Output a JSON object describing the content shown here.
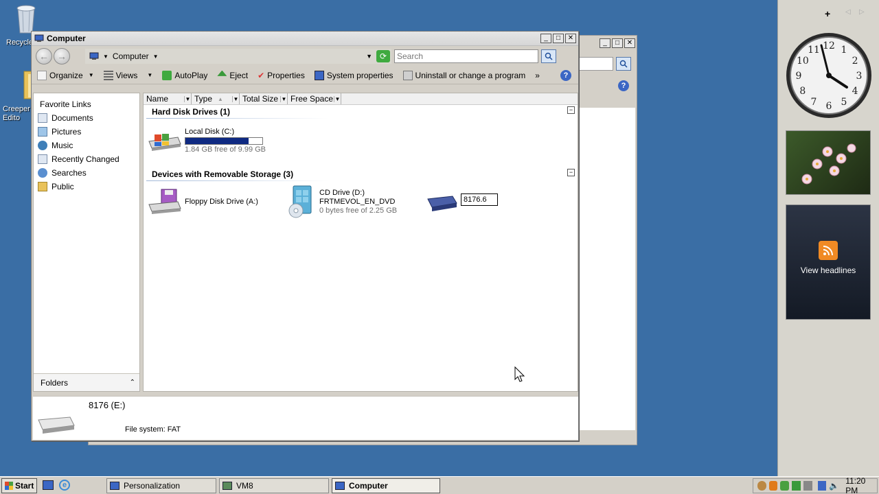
{
  "desktop": {
    "icons": [
      {
        "label": "Recycle"
      },
      {
        "label": "Creeper Edito"
      }
    ]
  },
  "window": {
    "title": "Computer",
    "controls": {
      "minimize": "_",
      "maximize": "□",
      "close": "✕"
    },
    "address": {
      "location": "Computer"
    },
    "search": {
      "placeholder": "Search"
    },
    "toolbar": {
      "organize": "Organize",
      "views": "Views",
      "autoplay": "AutoPlay",
      "eject": "Eject",
      "properties": "Properties",
      "system_properties": "System properties",
      "uninstall": "Uninstall or change a program",
      "more": "»"
    },
    "nav": {
      "header": "Favorite Links",
      "items": [
        {
          "label": "Documents"
        },
        {
          "label": "Pictures"
        },
        {
          "label": "Music"
        },
        {
          "label": "Recently Changed"
        },
        {
          "label": "Searches"
        },
        {
          "label": "Public"
        }
      ],
      "folders": "Folders"
    },
    "columns": [
      "Name",
      "Type",
      "Total Size",
      "Free Space"
    ],
    "groups": {
      "hdd": {
        "title": "Hard Disk Drives (1)",
        "items": [
          {
            "name": "Local Disk (C:)",
            "free": "1.84 GB free of 9.99 GB",
            "used_fraction": 0.82
          }
        ]
      },
      "removable": {
        "title": "Devices with Removable Storage (3)",
        "floppy": {
          "name": "Floppy Disk Drive (A:)"
        },
        "cd": {
          "name": "CD Drive (D:)",
          "volume": "FRTMEVOL_EN_DVD",
          "free": "0 bytes free of 2.25 GB"
        },
        "usb": {
          "rename_value": "8176.6"
        }
      }
    },
    "details": {
      "name": "8176 (E:)",
      "filesystem": "File system: FAT"
    }
  },
  "sidebar": {
    "rss_label": "View headlines",
    "clock_numbers": [
      "12",
      "1",
      "2",
      "3",
      "4",
      "5",
      "6",
      "7",
      "8",
      "9",
      "10",
      "11"
    ]
  },
  "taskbar": {
    "start": "Start",
    "tasks": [
      {
        "label": "Personalization"
      },
      {
        "label": "VM8"
      },
      {
        "label": "Computer"
      }
    ],
    "time": "11:20 PM"
  },
  "colors": {
    "desktop": "#3a6ea5",
    "disk_fill": "#0f2a82",
    "accent": "#3b66c4"
  }
}
